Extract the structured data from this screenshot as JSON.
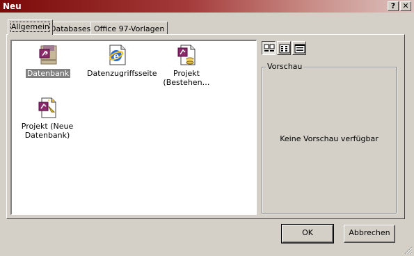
{
  "window": {
    "title": "Neu",
    "help_button": "?",
    "close_button": "✕"
  },
  "tabs": [
    {
      "label": "Allgemein",
      "active": true
    },
    {
      "label": "Databases",
      "active": false
    },
    {
      "label": "Office 97-Vorlagen",
      "active": false
    }
  ],
  "items": [
    {
      "label": "Datenbank",
      "icon": "access-database-icon",
      "selected": true
    },
    {
      "label": "Datenzugriffsseite",
      "icon": "data-access-page-icon",
      "selected": false
    },
    {
      "label": "Projekt (Bestehen…",
      "icon": "project-existing-icon",
      "selected": false
    },
    {
      "label": "Projekt (Neue Datenbank)",
      "icon": "project-new-database-icon",
      "selected": false
    }
  ],
  "view_buttons": [
    {
      "name": "large-icons-view",
      "pressed": true
    },
    {
      "name": "list-view",
      "pressed": false
    },
    {
      "name": "details-view",
      "pressed": false
    }
  ],
  "preview": {
    "legend": "Vorschau",
    "empty_text": "Keine Vorschau verfügbar"
  },
  "buttons": {
    "ok": "OK",
    "cancel": "Abbrechen"
  },
  "colors": {
    "title_start": "#7a0a08",
    "dialog_bg": "#d4d0c8",
    "selection": "#808080"
  }
}
